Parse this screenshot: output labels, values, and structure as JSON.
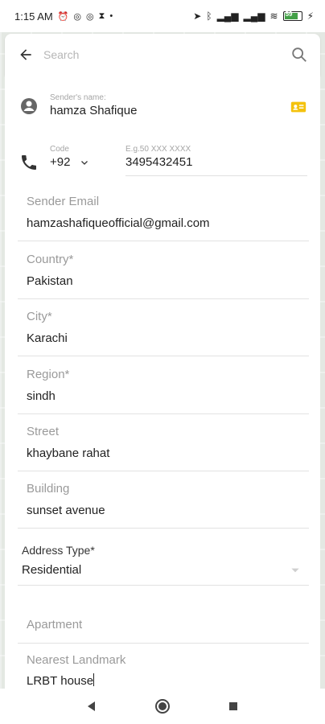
{
  "status_bar": {
    "time": "1:15 AM",
    "battery": "59"
  },
  "search": {
    "placeholder": "Search"
  },
  "sender": {
    "label": "Sender's name:",
    "name": "hamza Shafique"
  },
  "phone": {
    "code_label": "Code",
    "code_value": "+92",
    "number_placeholder": "E.g.50 XXX XXXX",
    "number_value": "3495432451"
  },
  "fields": {
    "email": {
      "label": "Sender Email",
      "value": "hamzashafiqueofficial@gmail.com"
    },
    "country": {
      "label": "Country*",
      "value": "Pakistan"
    },
    "city": {
      "label": "City*",
      "value": "Karachi"
    },
    "region": {
      "label": "Region*",
      "value": "sindh"
    },
    "street": {
      "label": "Street",
      "value": "khaybane rahat"
    },
    "building": {
      "label": "Building",
      "value": "sunset avenue"
    },
    "address_type": {
      "label": "Address Type*",
      "value": "Residential"
    },
    "apartment": {
      "label": "Apartment",
      "value": ""
    },
    "landmark": {
      "label": "Nearest Landmark",
      "value": "LRBT house"
    }
  },
  "colors": {
    "accent": "#f4c20d",
    "icon": "#444444"
  },
  "icons": {
    "back": "arrow-left-icon",
    "search": "search-icon",
    "person": "person-icon",
    "contact": "contact-card-icon",
    "phone": "phone-icon",
    "dropdown": "chevron-down-icon"
  }
}
